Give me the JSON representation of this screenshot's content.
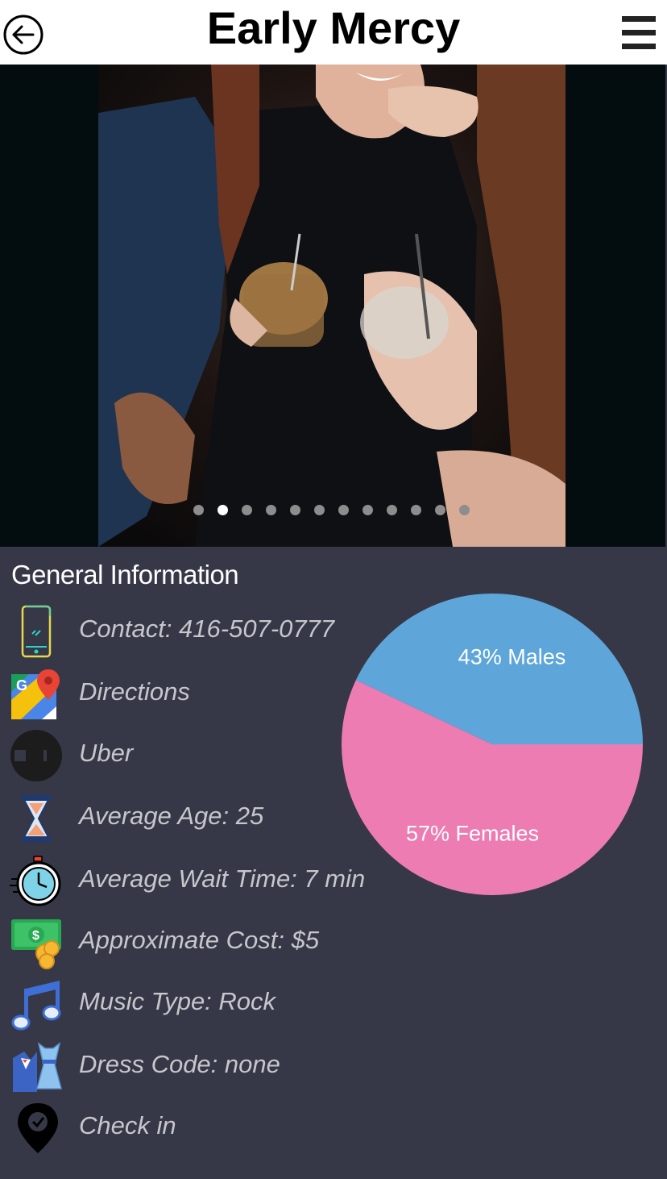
{
  "header": {
    "title": "Early Mercy",
    "back_icon": "arrow-left-circle-icon",
    "menu_icon": "hamburger-menu-icon"
  },
  "gallery": {
    "slide_count": 12,
    "active_index": 1
  },
  "general_info": {
    "title": "General Information",
    "items": [
      {
        "icon": "smartphone-icon",
        "label": "Contact: 416-507-0777"
      },
      {
        "icon": "google-maps-icon",
        "label": "Directions"
      },
      {
        "icon": "uber-icon",
        "label": "Uber"
      },
      {
        "icon": "hourglass-icon",
        "label": "Average Age: 25"
      },
      {
        "icon": "stopwatch-icon",
        "label": "Average Wait Time: 7 min"
      },
      {
        "icon": "money-icon",
        "label": "Approximate Cost: $5"
      },
      {
        "icon": "music-note-icon",
        "label": "Music Type: Rock"
      },
      {
        "icon": "dress-code-icon",
        "label": "Dress Code: none"
      },
      {
        "icon": "location-pin-check-icon",
        "label": "Check in"
      }
    ]
  },
  "chart_data": {
    "type": "pie",
    "slices": [
      {
        "label": "43% Males",
        "value": 43,
        "color": "#5ea6d9"
      },
      {
        "label": "57% Females",
        "value": 57,
        "color": "#ec7cb2"
      }
    ]
  }
}
